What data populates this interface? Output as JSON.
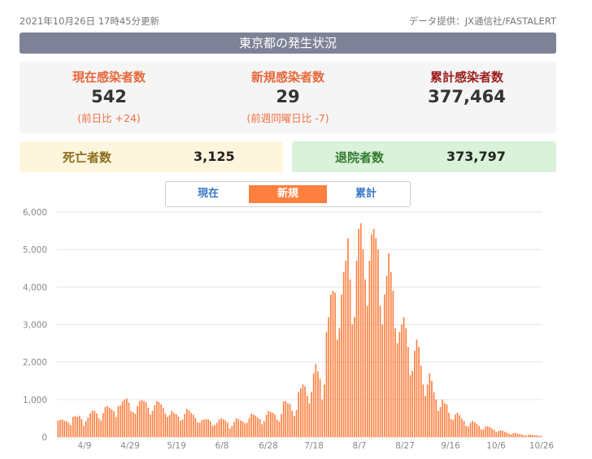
{
  "header": {
    "updated": "2021年10月26日 17時45分更新",
    "source": "データ提供：JX通信社/FASTALERT"
  },
  "title": "東京都の発生状況",
  "stats": {
    "current": {
      "label": "現在感染者数",
      "value": "542",
      "sub": "(前日比 +24)"
    },
    "new": {
      "label": "新規感染者数",
      "value": "29",
      "sub": "(前週同曜日比 -7)"
    },
    "total": {
      "label": "累計感染者数",
      "value": "377,464"
    }
  },
  "deaths": {
    "label": "死亡者数",
    "value": "3,125"
  },
  "recovered": {
    "label": "退院者数",
    "value": "373,797"
  },
  "tabs": {
    "current": "現在",
    "new": "新規",
    "total": "累計"
  },
  "colors": {
    "bar": "#ff7f3f",
    "title_bg": "#7d8296",
    "grid": "#e6e6e6"
  },
  "chart_data": {
    "type": "bar",
    "title": "",
    "xlabel": "",
    "ylabel": "",
    "ylim": [
      0,
      6000
    ],
    "yticks": [
      "0",
      "1,000",
      "2,000",
      "3,000",
      "4,000",
      "5,000",
      "6,000"
    ],
    "xticks": [
      "4/9",
      "4/29",
      "5/19",
      "6/8",
      "6/28",
      "7/18",
      "8/7",
      "8/27",
      "9/16",
      "10/6",
      "10/26"
    ],
    "grid": true,
    "series": [
      {
        "values": [
          440,
          460,
          470,
          430,
          420,
          380,
          320,
          540,
          560,
          540,
          570,
          480,
          300,
          420,
          520,
          630,
          700,
          700,
          630,
          500,
          440,
          640,
          800,
          830,
          780,
          740,
          690,
          540,
          820,
          840,
          950,
          1000,
          1030,
          920,
          690,
          660,
          620,
          830,
          960,
          990,
          960,
          930,
          780,
          600,
          700,
          850,
          960,
          930,
          870,
          780,
          620,
          540,
          590,
          700,
          650,
          610,
          550,
          440,
          470,
          620,
          750,
          710,
          640,
          600,
          500,
          390,
          380,
          460,
          470,
          480,
          470,
          420,
          300,
          320,
          380,
          460,
          500,
          470,
          440,
          380,
          230,
          300,
          400,
          500,
          480,
          440,
          420,
          370,
          380,
          500,
          620,
          600,
          570,
          520,
          480,
          340,
          420,
          590,
          700,
          670,
          650,
          600,
          470,
          420,
          620,
          950,
          960,
          900,
          880,
          700,
          560,
          720,
          1200,
          1300,
          1400,
          1350,
          1100,
          900,
          1200,
          1700,
          1950,
          1750,
          1550,
          1000,
          1400,
          2800,
          3200,
          3800,
          3900,
          3850,
          2600,
          2900,
          3800,
          4400,
          4700,
          5300,
          4200,
          3000,
          3200,
          4700,
          5550,
          5700,
          5000,
          4200,
          3500,
          4700,
          5400,
          5550,
          5300,
          5000,
          3500,
          3000,
          3800,
          4300,
          4900,
          4400,
          3900,
          2900,
          2500,
          2800,
          3000,
          3200,
          2900,
          2400,
          1650,
          1760,
          2300,
          2600,
          2400,
          1900,
          1400,
          1100,
          1400,
          1700,
          1500,
          1200,
          1000,
          700,
          800,
          1000,
          900,
          870,
          650,
          480,
          460,
          600,
          650,
          580,
          490,
          430,
          300,
          280,
          380,
          430,
          400,
          350,
          300,
          210,
          200,
          280,
          290,
          270,
          230,
          190,
          130,
          160,
          180,
          170,
          140,
          120,
          90,
          70,
          100,
          110,
          90,
          80,
          70,
          50,
          40,
          60,
          65,
          60,
          50,
          45,
          35,
          30
        ]
      }
    ]
  }
}
